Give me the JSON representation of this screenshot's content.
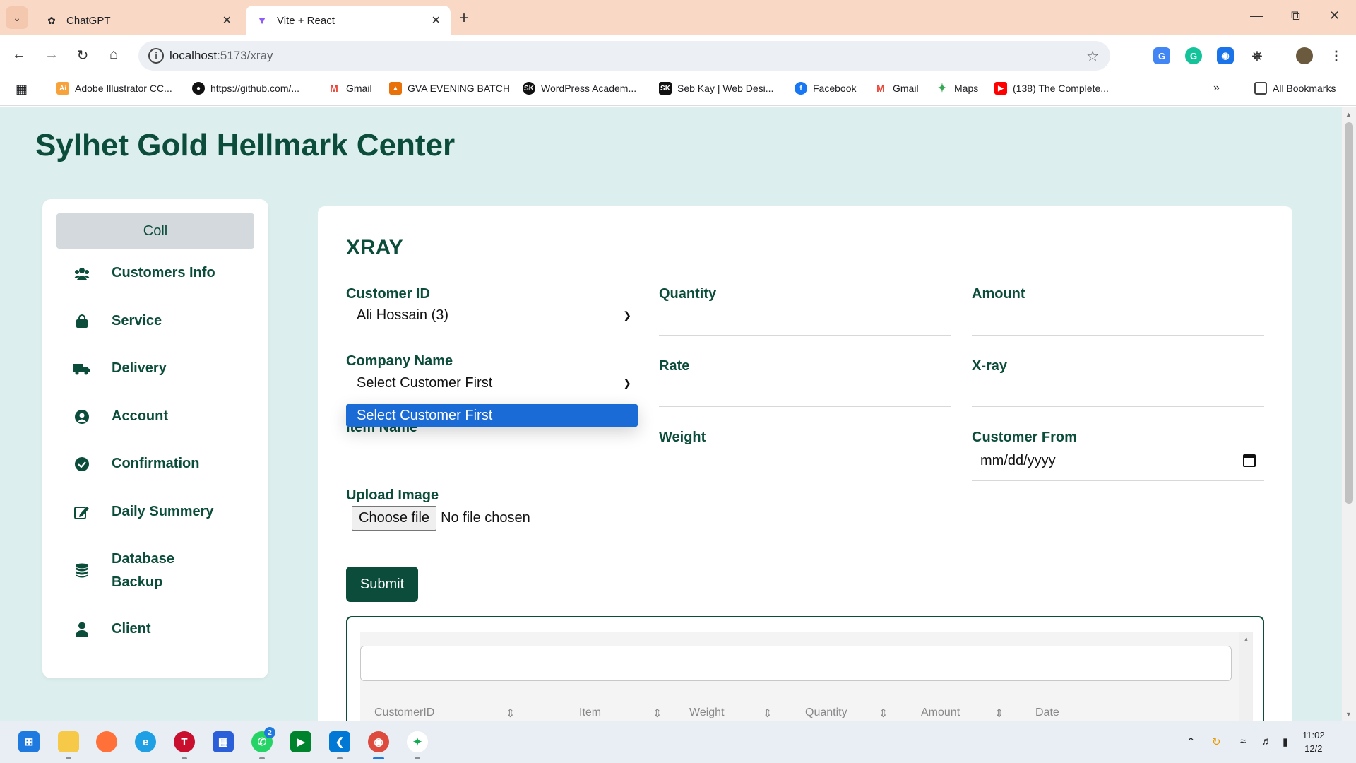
{
  "browser": {
    "tabs": [
      {
        "label": "ChatGPT",
        "icon": "chatgpt-icon",
        "active": false
      },
      {
        "label": "Vite + React",
        "icon": "vite-icon",
        "active": true
      }
    ],
    "url_host": "localhost",
    "url_path": ":5173/xray",
    "bookmarks": [
      {
        "label": "Adobe Illustrator CC...",
        "icon": "illustrator-icon",
        "color": "#f7a23b"
      },
      {
        "label": "https://github.com/...",
        "icon": "github-icon",
        "color": "#111111"
      },
      {
        "label": "Gmail",
        "icon": "gmail-icon",
        "color": "#ea4335"
      },
      {
        "label": "GVA EVENING BATCH",
        "icon": "gva-icon",
        "color": "#e8710a"
      },
      {
        "label": "WordPress Academ...",
        "icon": "sk-icon",
        "color": "#111111"
      },
      {
        "label": "Seb Kay | Web Desi...",
        "icon": "sk-icon",
        "color": "#111111"
      },
      {
        "label": "Facebook",
        "icon": "facebook-icon",
        "color": "#1877f2"
      },
      {
        "label": "Gmail",
        "icon": "gmail-icon",
        "color": "#ea4335"
      },
      {
        "label": "Maps",
        "icon": "maps-icon",
        "color": "#34a853"
      },
      {
        "label": "(138) The Complete...",
        "icon": "youtube-icon",
        "color": "#ff0000"
      }
    ],
    "all_bookmarks_label": "All Bookmarks"
  },
  "site": {
    "title": "Sylhet Gold Hellmark Center"
  },
  "sidebar": {
    "collapse_label": "Coll",
    "items": [
      {
        "label": "Customers Info",
        "icon": "users-icon"
      },
      {
        "label": "Service",
        "icon": "shopping-bag-icon"
      },
      {
        "label": "Delivery",
        "icon": "truck-icon"
      },
      {
        "label": "Account",
        "icon": "user-circle-icon"
      },
      {
        "label": "Confirmation",
        "icon": "check-circle-icon"
      },
      {
        "label": "Daily Summery",
        "icon": "edit-icon"
      },
      {
        "label": "Database Backup",
        "icon": "database-icon"
      },
      {
        "label": "Client",
        "icon": "user-icon"
      }
    ]
  },
  "form": {
    "title": "XRAY",
    "customer_id": {
      "label": "Customer ID",
      "value": "Ali Hossain (3)"
    },
    "company_name": {
      "label": "Company Name",
      "value": "Select Customer First",
      "dropdown_option": "Select Customer First"
    },
    "item_name": {
      "label": "Item Name"
    },
    "upload_image": {
      "label": "Upload Image",
      "button": "Choose file",
      "status": "No file chosen"
    },
    "quantity": {
      "label": "Quantity"
    },
    "rate": {
      "label": "Rate"
    },
    "weight": {
      "label": "Weight"
    },
    "amount": {
      "label": "Amount"
    },
    "xray": {
      "label": "X-ray"
    },
    "customer_from": {
      "label": "Customer From",
      "placeholder": "mm/dd/yyyy"
    },
    "submit_label": "Submit"
  },
  "table": {
    "columns": [
      "CustomerID",
      "Item",
      "Weight",
      "Quantity",
      "Amount",
      "Date"
    ]
  },
  "taskbar": {
    "time": "11:02",
    "date": "12/2",
    "whatsapp_badge": "2"
  },
  "colors": {
    "brand": "#0b4d3a",
    "page_bg": "#dcefee",
    "dropdown_highlight": "#1a6bd6"
  }
}
